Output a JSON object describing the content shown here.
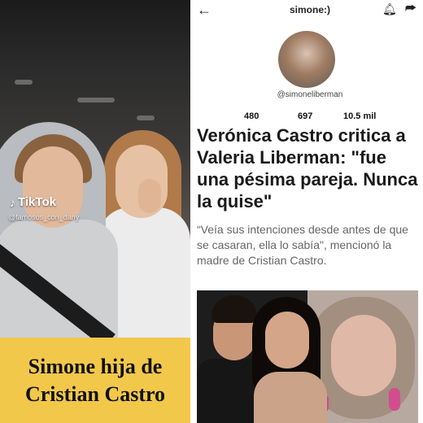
{
  "left_panel": {
    "tiktok_label": "TikTok",
    "tiktok_handle": "@famosos_con_dany",
    "caption_line1": "Simone hija de",
    "caption_line2": "Cristian Castro"
  },
  "profile": {
    "header_title": "simone:)",
    "handle": "@simoneliberman",
    "stats": [
      "480",
      "697",
      "10.5 mil"
    ]
  },
  "article": {
    "headline": "Verónica Castro critica a Valeria Liberman: \"fue una pésima pareja. Nunca la quise\"",
    "subtext": "“Veía sus intenciones desde antes de que se casaran, ella lo sabía\", mencionó la madre de Cristian Castro."
  },
  "colors": {
    "caption_bg": "#f2c84b"
  },
  "icons": {
    "back": "back-arrow-icon",
    "bell": "bell-icon",
    "share": "share-icon",
    "tiktok": "tiktok-logo-icon"
  }
}
